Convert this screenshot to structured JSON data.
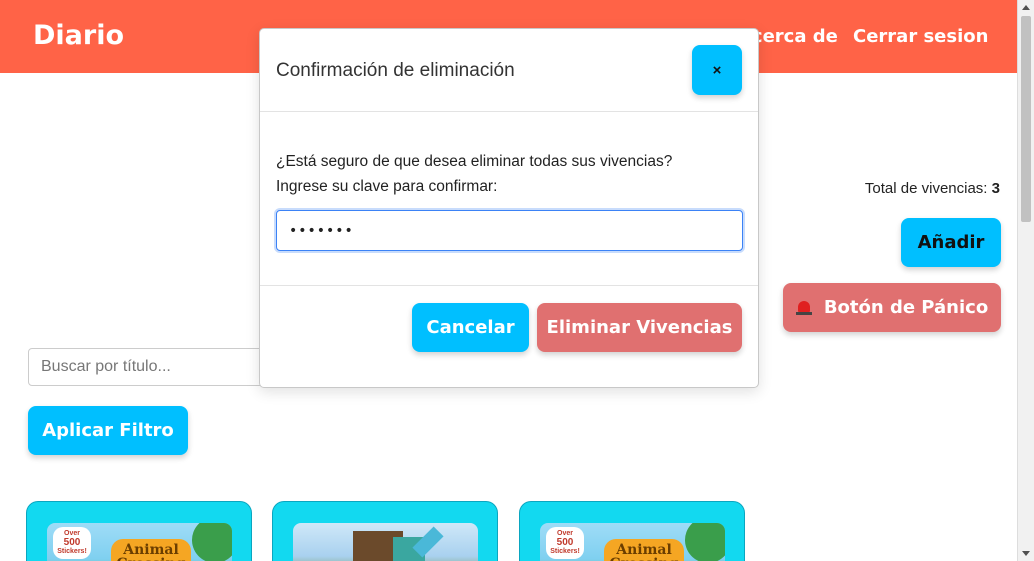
{
  "navbar": {
    "brand": "Diario",
    "about_label": "Acerca de",
    "logout_label": "Cerrar sesion"
  },
  "summary": {
    "total_label": "Total de vivencias:",
    "total_value": "3"
  },
  "actions": {
    "add_label": "Añadir",
    "panic_label": "Botón de Pánico"
  },
  "filter": {
    "search_placeholder": "Buscar por título...",
    "apply_label": "Aplicar Filtro"
  },
  "cards": [
    {
      "image": "animal-crossing-cover",
      "badge_top": "Over",
      "badge_num": "500",
      "badge_bottom": "Stickers!",
      "logo": "Animal Crossing"
    },
    {
      "image": "minecraft-cover"
    },
    {
      "image": "animal-crossing-cover",
      "badge_top": "Over",
      "badge_num": "500",
      "badge_bottom": "Stickers!",
      "logo": "Animal Crossing"
    }
  ],
  "modal": {
    "title": "Confirmación de eliminación",
    "close_label": "×",
    "question": "¿Está seguro de que desea eliminar todas sus vivencias?",
    "instruction": "Ingrese su clave para confirmar:",
    "password_value": "•••••••",
    "cancel_label": "Cancelar",
    "delete_label": "Eliminar Vivencias"
  },
  "colors": {
    "navbar": "#ff6347",
    "primary": "#00bfff",
    "danger": "#e07070",
    "card": "#12d9f0"
  }
}
